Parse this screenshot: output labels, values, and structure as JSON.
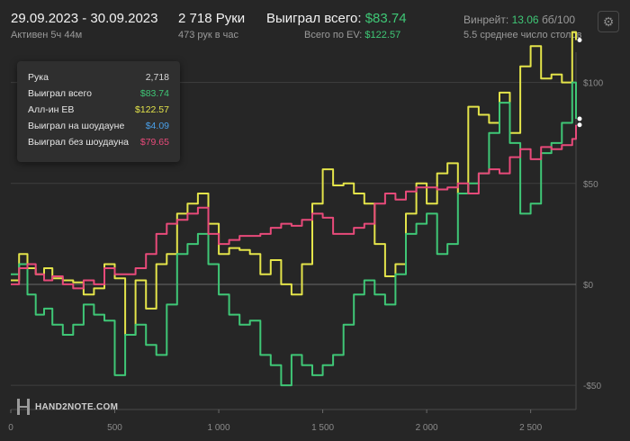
{
  "header": {
    "date_range": "29.09.2023 - 30.09.2023",
    "active": "Активен 5ч 44м",
    "hands": "2 718 Руки",
    "hands_per_hour": "473 рук в час",
    "won_label": "Выиграл всего:",
    "won_value": "$83.74",
    "ev_label": "Всего по EV:",
    "ev_value": "$122.57",
    "winrate_label": "Винрейт:",
    "winrate_value": "13.06",
    "winrate_unit": "бб/100",
    "tables": "5.5 среднее число столов"
  },
  "settings_icon": "gear-icon",
  "tooltip": {
    "rows": [
      {
        "label": "Рука",
        "value": "2,718",
        "color": "#d8d8d8"
      },
      {
        "label": "Выиграл всего",
        "value": "$83.74",
        "color": "#3fc776"
      },
      {
        "label": "Алл-ин EB",
        "value": "$122.57",
        "color": "#e4e44a"
      },
      {
        "label": "Выиграл на шоудауне",
        "value": "$4.09",
        "color": "#4a9fe8"
      },
      {
        "label": "Выиграл без шоудауна",
        "value": "$79.65",
        "color": "#e84a7a"
      }
    ]
  },
  "logo": {
    "text": "HAND2NOTE.COM"
  },
  "chart_data": {
    "type": "line",
    "xlim": [
      0,
      2718
    ],
    "ylim": [
      -62,
      115
    ],
    "x_ticks": [
      0,
      500,
      1000,
      1500,
      2000,
      2500
    ],
    "x_tick_labels": [
      "0",
      "500",
      "1 000",
      "1 500",
      "2 000",
      "2 500"
    ],
    "y_ticks": [
      100,
      50,
      0,
      -50
    ],
    "y_tick_labels": [
      "$100",
      "$50",
      "$0",
      "-$50"
    ],
    "grid": true,
    "series": [
      {
        "name": "Алл-ин EB",
        "color": "#e4e44a",
        "x": [
          0,
          40,
          80,
          120,
          160,
          200,
          250,
          300,
          350,
          400,
          450,
          500,
          550,
          600,
          650,
          700,
          750,
          800,
          850,
          900,
          950,
          1000,
          1050,
          1100,
          1150,
          1200,
          1250,
          1300,
          1350,
          1400,
          1450,
          1500,
          1550,
          1600,
          1650,
          1700,
          1750,
          1800,
          1850,
          1900,
          1950,
          2000,
          2050,
          2100,
          2150,
          2200,
          2250,
          2300,
          2350,
          2400,
          2450,
          2500,
          2550,
          2600,
          2650,
          2700,
          2718
        ],
        "y": [
          2,
          15,
          8,
          5,
          8,
          3,
          2,
          1,
          -5,
          -2,
          10,
          3,
          -25,
          2,
          -12,
          10,
          15,
          35,
          40,
          45,
          30,
          15,
          18,
          17,
          15,
          5,
          12,
          0,
          -5,
          10,
          40,
          57,
          49,
          50,
          45,
          40,
          20,
          4,
          10,
          35,
          50,
          40,
          55,
          60,
          45,
          88,
          84,
          80,
          95,
          75,
          108,
          118,
          102,
          104,
          100,
          125,
          121
        ]
      },
      {
        "name": "Выиграл всего",
        "color": "#3fc776",
        "x": [
          0,
          40,
          80,
          120,
          160,
          200,
          250,
          300,
          350,
          400,
          450,
          500,
          550,
          600,
          650,
          700,
          750,
          800,
          850,
          900,
          950,
          1000,
          1050,
          1100,
          1150,
          1200,
          1250,
          1300,
          1350,
          1400,
          1450,
          1500,
          1550,
          1600,
          1650,
          1700,
          1750,
          1800,
          1850,
          1900,
          1950,
          2000,
          2050,
          2100,
          2150,
          2200,
          2250,
          2300,
          2350,
          2400,
          2450,
          2500,
          2550,
          2600,
          2650,
          2700,
          2718
        ],
        "y": [
          5,
          10,
          -5,
          -15,
          -12,
          -20,
          -25,
          -20,
          -10,
          -15,
          -18,
          -45,
          -25,
          -20,
          -30,
          -35,
          -10,
          15,
          20,
          25,
          10,
          -5,
          -15,
          -20,
          -18,
          -35,
          -40,
          -50,
          -35,
          -40,
          -45,
          -40,
          -35,
          -20,
          -5,
          2,
          -5,
          -10,
          5,
          25,
          30,
          35,
          15,
          20,
          45,
          50,
          55,
          75,
          90,
          70,
          35,
          40,
          65,
          70,
          80,
          100,
          82
        ]
      },
      {
        "name": "Выиграл без шоудауна",
        "color": "#e84a7a",
        "x": [
          0,
          40,
          80,
          120,
          160,
          200,
          250,
          300,
          350,
          400,
          450,
          500,
          550,
          600,
          650,
          700,
          750,
          800,
          850,
          900,
          950,
          1000,
          1050,
          1100,
          1150,
          1200,
          1250,
          1300,
          1350,
          1400,
          1450,
          1500,
          1550,
          1600,
          1650,
          1700,
          1750,
          1800,
          1850,
          1900,
          1950,
          2000,
          2050,
          2100,
          2150,
          2200,
          2250,
          2300,
          2350,
          2400,
          2450,
          2500,
          2550,
          2600,
          2650,
          2700,
          2718
        ],
        "y": [
          0,
          8,
          10,
          5,
          2,
          4,
          0,
          -2,
          2,
          0,
          8,
          5,
          5,
          8,
          15,
          25,
          30,
          32,
          35,
          38,
          25,
          20,
          22,
          24,
          24,
          25,
          28,
          30,
          29,
          32,
          35,
          33,
          25,
          25,
          28,
          30,
          40,
          45,
          42,
          46,
          48,
          48,
          47,
          48,
          50,
          45,
          55,
          57,
          55,
          63,
          67,
          62,
          68,
          67,
          69,
          72,
          79
        ]
      }
    ]
  }
}
